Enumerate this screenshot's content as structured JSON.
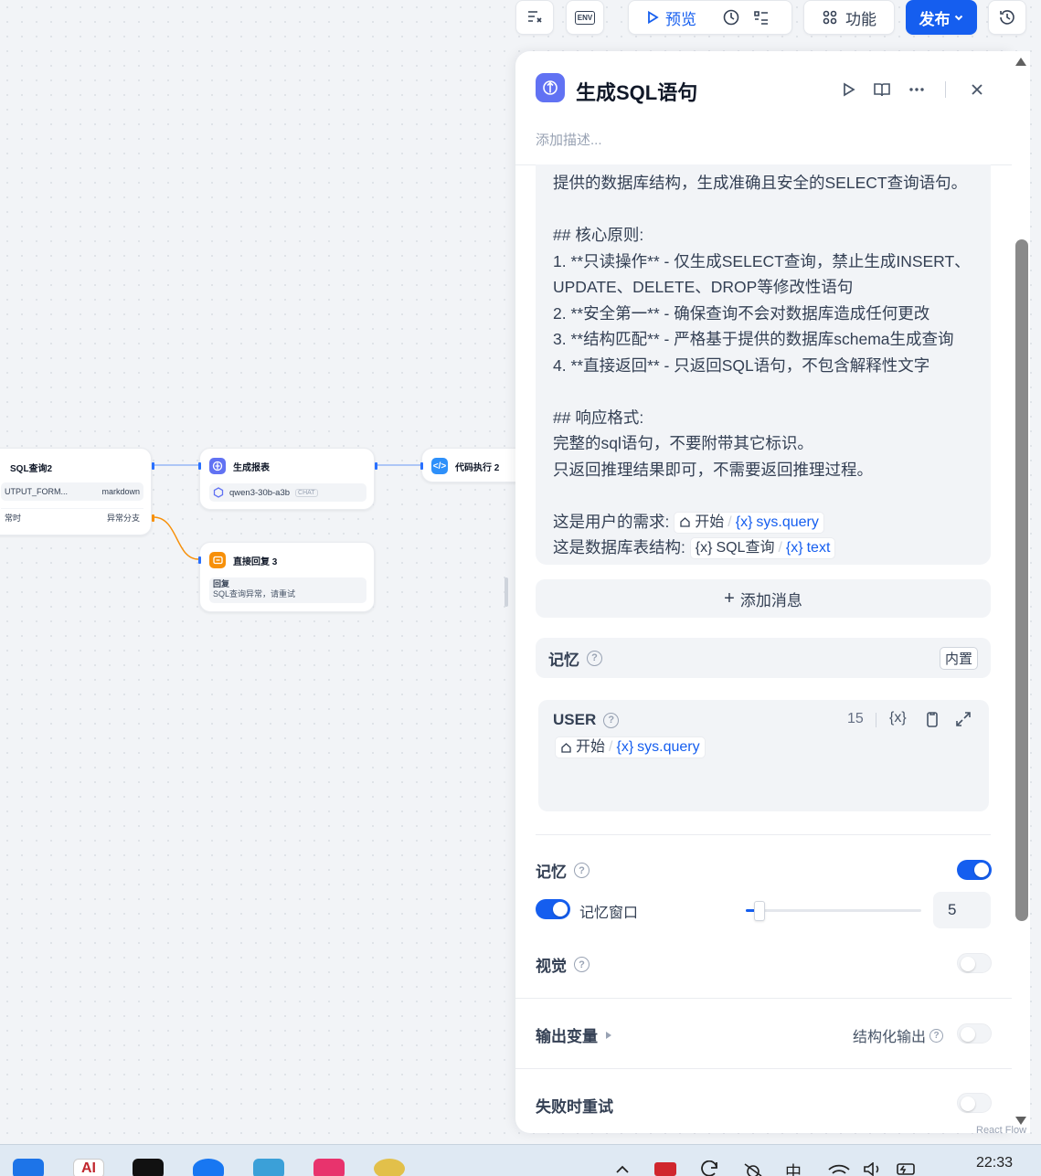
{
  "toolbar": {
    "env_label": "ENV",
    "preview_label": "预览",
    "features_label": "功能",
    "publish_label": "发布"
  },
  "canvas": {
    "node_sql": {
      "title": "SQL查询2",
      "row1_key": "UTPUT_FORM...",
      "row1_val": "markdown",
      "row2_key": "常时",
      "row2_val": "异常分支"
    },
    "node_report": {
      "title": "生成报表",
      "model": "qwen3-30b-a3b",
      "model_tag": "CHAT"
    },
    "node_code": {
      "title": "代码执行 2"
    },
    "node_reply": {
      "title": "直接回复 3",
      "label": "回复",
      "text": "SQL查询异常，请重试"
    },
    "watermark": "React Flow"
  },
  "panel": {
    "title": "生成SQL语句",
    "description_placeholder": "添加描述...",
    "prompt_lines": [
      "提供的数据库结构，生成准确且安全的SELECT查询语句。",
      "",
      "## 核心原则:",
      "1. **只读操作** - 仅生成SELECT查询，禁止生成INSERT、",
      "UPDATE、DELETE、DROP等修改性语句",
      "2. **安全第一** - 确保查询不会对数据库造成任何更改",
      "3. **结构匹配** - 严格基于提供的数据库schema生成查询",
      "4. **直接返回** - 只返回SQL语句，不包含解释性文字",
      "",
      "## 响应格式:",
      "完整的sql语句，不要附带其它标识。",
      "只返回推理结果即可，不需要返回推理过程。",
      ""
    ],
    "var_line1_prefix": "这是用户的需求:",
    "var_line1_node": "开始",
    "var_line1_var": "sys.query",
    "var_line2_prefix": "这是数据库表结构:",
    "var_line2_node": "SQL查询",
    "var_line2_var": "text",
    "add_message_label": "添加消息",
    "memory_section_label": "记忆",
    "memory_badge": "内置",
    "user_label": "USER",
    "user_count": "15",
    "user_var_node": "开始",
    "user_var": "sys.query",
    "memory_label": "记忆",
    "memory_window_label": "记忆窗口",
    "memory_window_value": "5",
    "memory_window_fraction": 0.05,
    "vision_label": "视觉",
    "output_vars_label": "输出变量",
    "structured_output_label": "结构化输出",
    "retry_label": "失败时重试"
  },
  "taskbar": {
    "time": "22:33"
  },
  "colors": {
    "accent": "#155eef",
    "node_blue": "#6172f3",
    "node_orange": "#f79009",
    "code_blue": "#2e90fa"
  }
}
